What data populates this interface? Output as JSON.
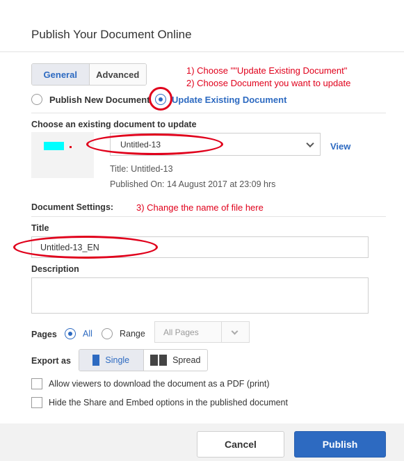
{
  "dialog": {
    "title": "Publish Your Document Online"
  },
  "tabs": [
    {
      "label": "General",
      "active": true
    },
    {
      "label": "Advanced",
      "active": false
    }
  ],
  "annotations": {
    "step1": "1) Choose \"\"Update Existing Document\"",
    "step2": "2) Choose Document you want to update",
    "step3": "3) Change the name of file here"
  },
  "mode": {
    "publish_new": "Publish New Document",
    "update_existing": "Update Existing Document",
    "selected": "update_existing"
  },
  "existing": {
    "heading": "Choose an existing document to update",
    "selected_doc": "Untitled-13",
    "view_link": "View",
    "title_line": "Title: Untitled-13",
    "published_line": "Published On: 14 August 2017 at 23:09 hrs"
  },
  "settings": {
    "heading": "Document Settings:",
    "title_label": "Title",
    "title_value": "Untitled-13_EN",
    "description_label": "Description",
    "description_value": ""
  },
  "pages": {
    "label": "Pages",
    "all_label": "All",
    "range_label": "Range",
    "range_placeholder": "All Pages",
    "selected": "all"
  },
  "export": {
    "label": "Export as",
    "single": "Single",
    "spread": "Spread",
    "selected": "single"
  },
  "options": [
    {
      "label": "Allow viewers to download the document as a PDF (print)",
      "checked": false
    },
    {
      "label": "Hide the Share and Embed options in the published document",
      "checked": false
    }
  ],
  "footer": {
    "cancel": "Cancel",
    "publish": "Publish"
  },
  "colors": {
    "accent": "#2d6ac1",
    "annotation": "#e0001b",
    "thumb_fill": "#00ffff"
  }
}
